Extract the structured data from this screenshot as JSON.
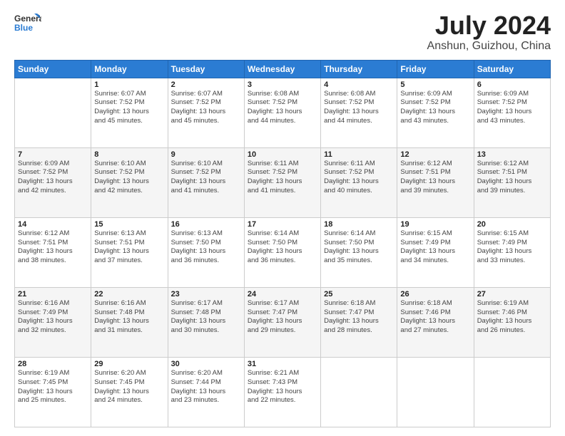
{
  "header": {
    "logo_line1": "General",
    "logo_line2": "Blue",
    "month": "July 2024",
    "location": "Anshun, Guizhou, China"
  },
  "weekdays": [
    "Sunday",
    "Monday",
    "Tuesday",
    "Wednesday",
    "Thursday",
    "Friday",
    "Saturday"
  ],
  "weeks": [
    [
      {
        "num": "",
        "info": ""
      },
      {
        "num": "1",
        "info": "Sunrise: 6:07 AM\nSunset: 7:52 PM\nDaylight: 13 hours\nand 45 minutes."
      },
      {
        "num": "2",
        "info": "Sunrise: 6:07 AM\nSunset: 7:52 PM\nDaylight: 13 hours\nand 45 minutes."
      },
      {
        "num": "3",
        "info": "Sunrise: 6:08 AM\nSunset: 7:52 PM\nDaylight: 13 hours\nand 44 minutes."
      },
      {
        "num": "4",
        "info": "Sunrise: 6:08 AM\nSunset: 7:52 PM\nDaylight: 13 hours\nand 44 minutes."
      },
      {
        "num": "5",
        "info": "Sunrise: 6:09 AM\nSunset: 7:52 PM\nDaylight: 13 hours\nand 43 minutes."
      },
      {
        "num": "6",
        "info": "Sunrise: 6:09 AM\nSunset: 7:52 PM\nDaylight: 13 hours\nand 43 minutes."
      }
    ],
    [
      {
        "num": "7",
        "info": "Sunrise: 6:09 AM\nSunset: 7:52 PM\nDaylight: 13 hours\nand 42 minutes."
      },
      {
        "num": "8",
        "info": "Sunrise: 6:10 AM\nSunset: 7:52 PM\nDaylight: 13 hours\nand 42 minutes."
      },
      {
        "num": "9",
        "info": "Sunrise: 6:10 AM\nSunset: 7:52 PM\nDaylight: 13 hours\nand 41 minutes."
      },
      {
        "num": "10",
        "info": "Sunrise: 6:11 AM\nSunset: 7:52 PM\nDaylight: 13 hours\nand 41 minutes."
      },
      {
        "num": "11",
        "info": "Sunrise: 6:11 AM\nSunset: 7:52 PM\nDaylight: 13 hours\nand 40 minutes."
      },
      {
        "num": "12",
        "info": "Sunrise: 6:12 AM\nSunset: 7:51 PM\nDaylight: 13 hours\nand 39 minutes."
      },
      {
        "num": "13",
        "info": "Sunrise: 6:12 AM\nSunset: 7:51 PM\nDaylight: 13 hours\nand 39 minutes."
      }
    ],
    [
      {
        "num": "14",
        "info": "Sunrise: 6:12 AM\nSunset: 7:51 PM\nDaylight: 13 hours\nand 38 minutes."
      },
      {
        "num": "15",
        "info": "Sunrise: 6:13 AM\nSunset: 7:51 PM\nDaylight: 13 hours\nand 37 minutes."
      },
      {
        "num": "16",
        "info": "Sunrise: 6:13 AM\nSunset: 7:50 PM\nDaylight: 13 hours\nand 36 minutes."
      },
      {
        "num": "17",
        "info": "Sunrise: 6:14 AM\nSunset: 7:50 PM\nDaylight: 13 hours\nand 36 minutes."
      },
      {
        "num": "18",
        "info": "Sunrise: 6:14 AM\nSunset: 7:50 PM\nDaylight: 13 hours\nand 35 minutes."
      },
      {
        "num": "19",
        "info": "Sunrise: 6:15 AM\nSunset: 7:49 PM\nDaylight: 13 hours\nand 34 minutes."
      },
      {
        "num": "20",
        "info": "Sunrise: 6:15 AM\nSunset: 7:49 PM\nDaylight: 13 hours\nand 33 minutes."
      }
    ],
    [
      {
        "num": "21",
        "info": "Sunrise: 6:16 AM\nSunset: 7:49 PM\nDaylight: 13 hours\nand 32 minutes."
      },
      {
        "num": "22",
        "info": "Sunrise: 6:16 AM\nSunset: 7:48 PM\nDaylight: 13 hours\nand 31 minutes."
      },
      {
        "num": "23",
        "info": "Sunrise: 6:17 AM\nSunset: 7:48 PM\nDaylight: 13 hours\nand 30 minutes."
      },
      {
        "num": "24",
        "info": "Sunrise: 6:17 AM\nSunset: 7:47 PM\nDaylight: 13 hours\nand 29 minutes."
      },
      {
        "num": "25",
        "info": "Sunrise: 6:18 AM\nSunset: 7:47 PM\nDaylight: 13 hours\nand 28 minutes."
      },
      {
        "num": "26",
        "info": "Sunrise: 6:18 AM\nSunset: 7:46 PM\nDaylight: 13 hours\nand 27 minutes."
      },
      {
        "num": "27",
        "info": "Sunrise: 6:19 AM\nSunset: 7:46 PM\nDaylight: 13 hours\nand 26 minutes."
      }
    ],
    [
      {
        "num": "28",
        "info": "Sunrise: 6:19 AM\nSunset: 7:45 PM\nDaylight: 13 hours\nand 25 minutes."
      },
      {
        "num": "29",
        "info": "Sunrise: 6:20 AM\nSunset: 7:45 PM\nDaylight: 13 hours\nand 24 minutes."
      },
      {
        "num": "30",
        "info": "Sunrise: 6:20 AM\nSunset: 7:44 PM\nDaylight: 13 hours\nand 23 minutes."
      },
      {
        "num": "31",
        "info": "Sunrise: 6:21 AM\nSunset: 7:43 PM\nDaylight: 13 hours\nand 22 minutes."
      },
      {
        "num": "",
        "info": ""
      },
      {
        "num": "",
        "info": ""
      },
      {
        "num": "",
        "info": ""
      }
    ]
  ]
}
